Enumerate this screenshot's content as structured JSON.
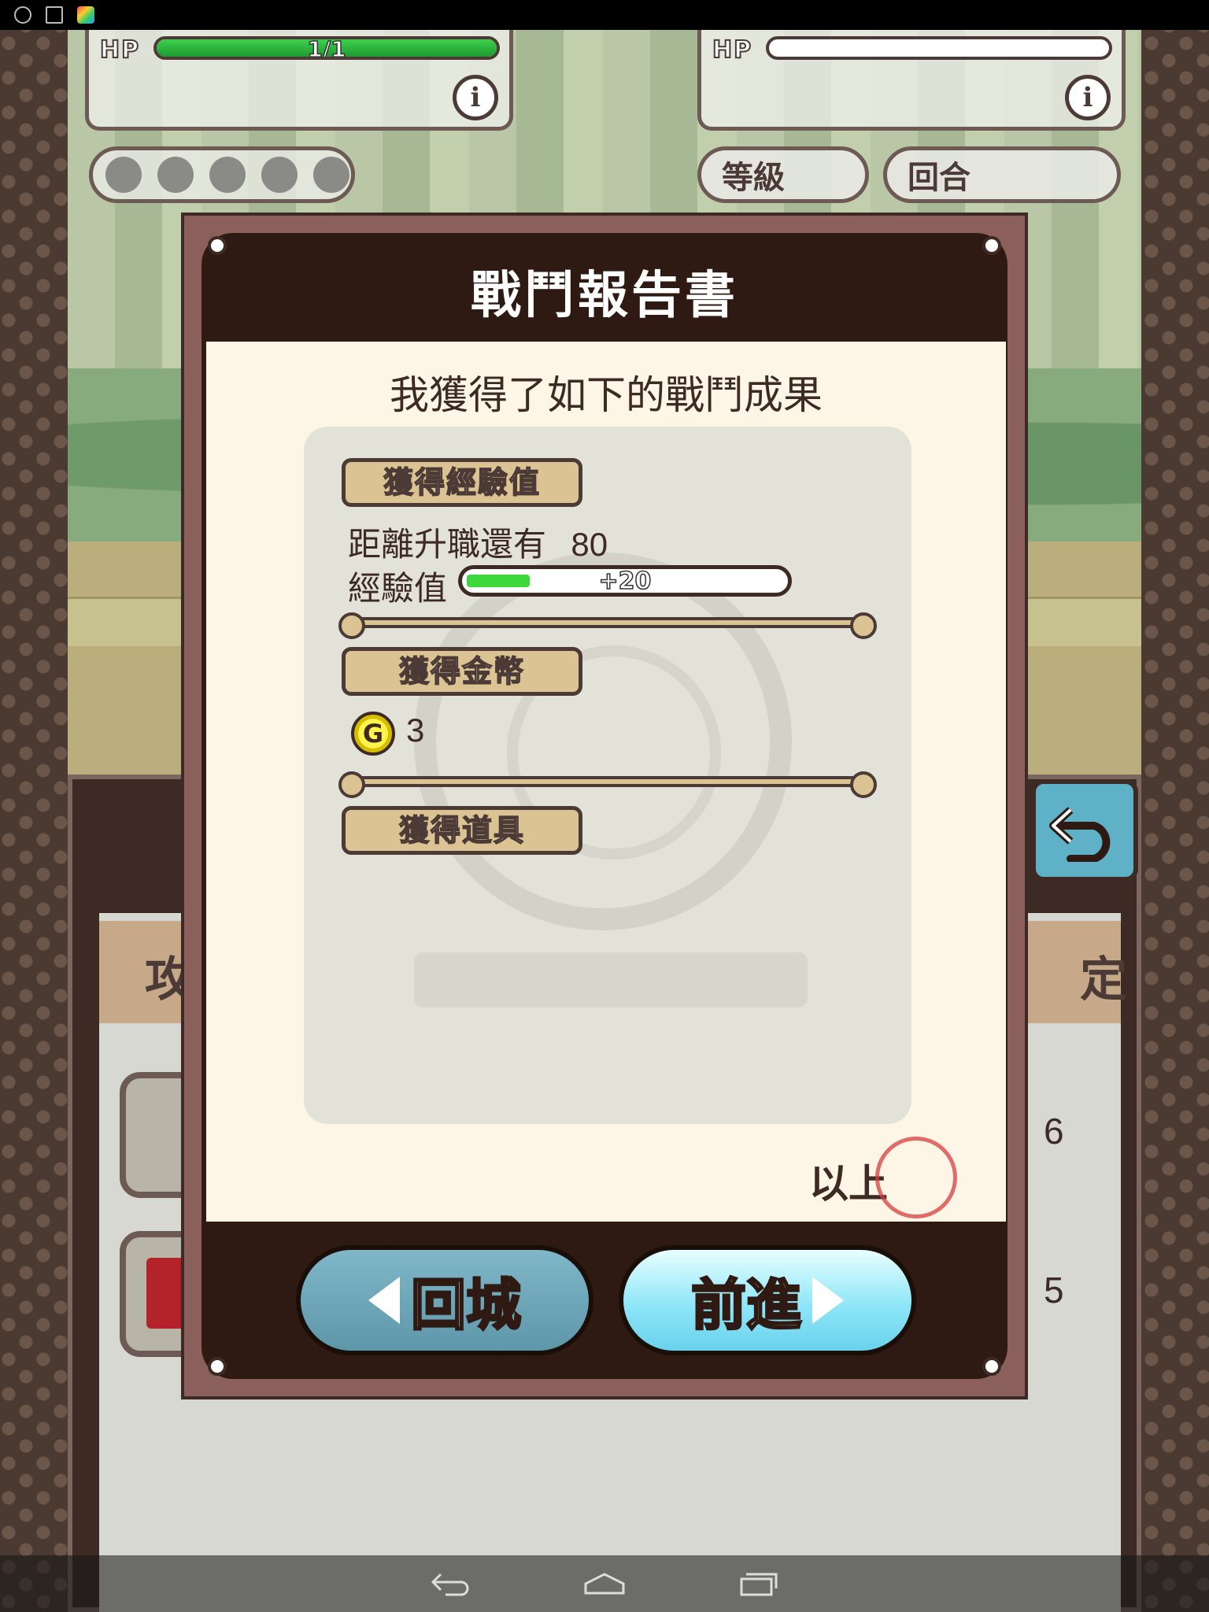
{
  "battle": {
    "player_hp_label": "HP",
    "player_hp_text": "1/1",
    "player_hp_fraction": 1.0,
    "enemy_hp_label": "HP",
    "level_label": "等級",
    "round_label": "回合",
    "skill_slots": 5
  },
  "menu": {
    "tab_left_partial": "攻",
    "tab_right_partial": "定",
    "slot_counts": [
      "6",
      "5"
    ]
  },
  "dialog": {
    "title": "戰鬥報告書",
    "subtitle": "我獲得了如下的戰鬥成果",
    "exp_section": {
      "tag": "獲得經驗值",
      "promotion_label": "距離升職還有",
      "promotion_value": "80",
      "exp_label": "經驗值",
      "exp_gain": "+20",
      "exp_fraction": 0.2
    },
    "gold_section": {
      "tag": "獲得金幣",
      "coin_symbol": "G",
      "amount": "3"
    },
    "items_section": {
      "tag": "獲得道具"
    },
    "closing_text": "以上",
    "buttons": {
      "return_label": "回城",
      "forward_label": "前進"
    }
  },
  "colors": {
    "frame_dark": "#2e1a12",
    "panel_cream": "#fdf6e6",
    "tag_tan": "#dcc393",
    "hp_green": "#3fd04f",
    "button_blue": "#8ee6f8"
  }
}
